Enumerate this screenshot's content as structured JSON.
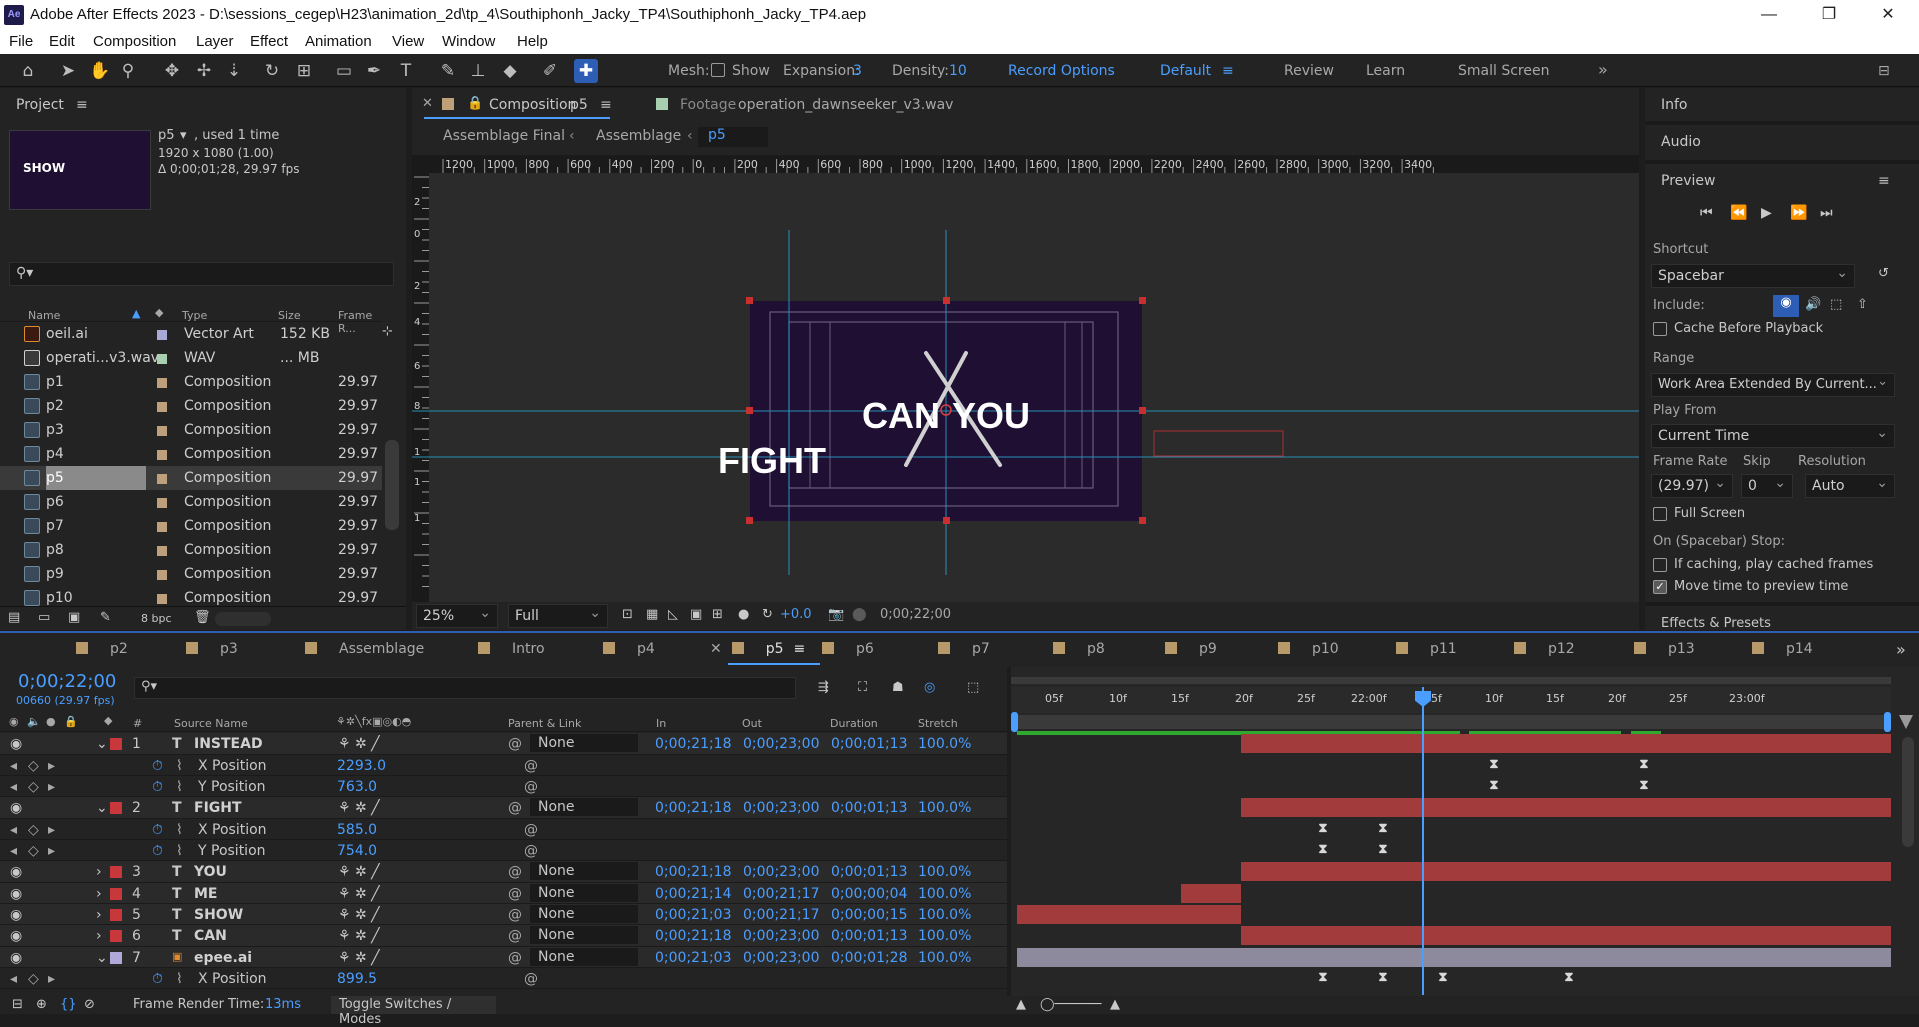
{
  "window": {
    "title": "Adobe After Effects 2023 - D:\\sessions_cegep\\H23\\animation_2d\\tp_4\\Southiphonh_Jacky_TP4\\Southiphonh_Jacky_TP4.aep",
    "app_icon": "Ae",
    "min": "—",
    "max": "❐",
    "close": "✕"
  },
  "menu": [
    "File",
    "Edit",
    "Composition",
    "Layer",
    "Effect",
    "Animation",
    "View",
    "Window",
    "Help"
  ],
  "toolbar": {
    "mesh_label": "Mesh:",
    "show_label": "Show",
    "expansion_label": "Expansion:",
    "expansion_value": "3",
    "density_label": "Density:",
    "density_value": "10",
    "record_options": "Record Options",
    "workspaces": [
      "Default",
      "Review",
      "Learn",
      "Small Screen"
    ],
    "more": "»"
  },
  "project": {
    "tab": "Project",
    "selected_name": "p5",
    "selected_used": ", used 1 time",
    "selected_res": "1920 x 1080 (1.00)",
    "selected_dur": "Δ 0;00;01;28, 29.97 fps",
    "thumb_text": "SHOW",
    "columns": {
      "name": "Name",
      "type": "Type",
      "size": "Size",
      "frame": "Frame R..."
    },
    "items": [
      {
        "name": "oeil.ai",
        "type": "Vector Art",
        "size": "152 KB",
        "frame": "",
        "color": "#a9a9d8",
        "kind": "ai"
      },
      {
        "name": "operati...v3.wav",
        "type": "WAV",
        "size": "... MB",
        "frame": "",
        "color": "#a8d0b0",
        "kind": "wav"
      },
      {
        "name": "p1",
        "type": "Composition",
        "size": "",
        "frame": "29.97",
        "color": "#c0a07a",
        "kind": "comp"
      },
      {
        "name": "p2",
        "type": "Composition",
        "size": "",
        "frame": "29.97",
        "color": "#c0a07a",
        "kind": "comp"
      },
      {
        "name": "p3",
        "type": "Composition",
        "size": "",
        "frame": "29.97",
        "color": "#c0a07a",
        "kind": "comp"
      },
      {
        "name": "p4",
        "type": "Composition",
        "size": "",
        "frame": "29.97",
        "color": "#c0a07a",
        "kind": "comp"
      },
      {
        "name": "p5",
        "type": "Composition",
        "size": "",
        "frame": "29.97",
        "color": "#c0a07a",
        "kind": "comp",
        "selected": true
      },
      {
        "name": "p6",
        "type": "Composition",
        "size": "",
        "frame": "29.97",
        "color": "#c0a07a",
        "kind": "comp"
      },
      {
        "name": "p7",
        "type": "Composition",
        "size": "",
        "frame": "29.97",
        "color": "#c0a07a",
        "kind": "comp"
      },
      {
        "name": "p8",
        "type": "Composition",
        "size": "",
        "frame": "29.97",
        "color": "#c0a07a",
        "kind": "comp"
      },
      {
        "name": "p9",
        "type": "Composition",
        "size": "",
        "frame": "29.97",
        "color": "#c0a07a",
        "kind": "comp"
      },
      {
        "name": "p10",
        "type": "Composition",
        "size": "",
        "frame": "29.97",
        "color": "#c0a07a",
        "kind": "comp"
      }
    ],
    "bpc": "8 bpc"
  },
  "viewer": {
    "comp_tab": "Composition",
    "comp_name": "p5",
    "footage_tab": "Footage",
    "footage_name": "operation_dawnseeker_v3.wav",
    "breadcrumbs": [
      "Assemblage Final",
      "Assemblage",
      "p5"
    ],
    "ruler_labels": [
      "1200",
      "1000",
      "800",
      "600",
      "400",
      "200",
      "0",
      "200",
      "400",
      "600",
      "800",
      "1000",
      "1200",
      "1400",
      "1600",
      "1800",
      "2000",
      "2200",
      "2400",
      "2600",
      "2800",
      "3000",
      "3200",
      "3400"
    ],
    "vruler": [
      "2",
      "0",
      "2",
      "4",
      "6",
      "8",
      "1",
      "1",
      "1"
    ],
    "words": {
      "can": "CAN",
      "you": "YOU",
      "fight": "FIGHT"
    },
    "zoom": "25%",
    "quality": "Full",
    "exposure": "+0.0",
    "timecode": "0;00;22;00"
  },
  "right": {
    "info": "Info",
    "audio": "Audio",
    "preview": "Preview",
    "shortcut_label": "Shortcut",
    "shortcut": "Spacebar",
    "include_label": "Include:",
    "cache_label": "Cache Before Playback",
    "range_label": "Range",
    "range": "Work Area Extended By Current...",
    "playfrom_label": "Play From",
    "playfrom": "Current Time",
    "framerate_label": "Frame Rate",
    "skip_label": "Skip",
    "resolution_label": "Resolution",
    "framerate": "(29.97)",
    "skip": "0",
    "resolution": "Auto",
    "fullscreen": "Full Screen",
    "onstop": "On (Spacebar) Stop:",
    "ifcaching": "If caching, play cached frames",
    "movetime": "Move time to preview time",
    "effects": "Effects & Presets"
  },
  "timeline": {
    "tabs": [
      "p2",
      "p3",
      "Assemblage",
      "Intro",
      "p4",
      "p5",
      "p6",
      "p7",
      "p8",
      "p9",
      "p10",
      "p11",
      "p12",
      "p13",
      "p14"
    ],
    "active_tab": "p5",
    "timecode": "0;00;22;00",
    "frames": "00660 (29.97 fps)",
    "cols": {
      "source": "Source Name",
      "parent": "Parent & Link",
      "in": "In",
      "out": "Out",
      "dur": "Duration",
      "stretch": "Stretch",
      "num": "#"
    },
    "ruler": [
      "05f",
      "10f",
      "15f",
      "20f",
      "25f",
      "22:00f",
      "05f",
      "10f",
      "15f",
      "20f",
      "25f",
      "23:00f"
    ],
    "layers": [
      {
        "kind": "layer",
        "num": "1",
        "name": "INSTEAD",
        "type": "T",
        "color": "#c8383a",
        "parent": "None",
        "in": "0;00;21;18",
        "out": "0;00;23;00",
        "dur": "0;00;01;13",
        "stretch": "100.0%",
        "expanded": true
      },
      {
        "kind": "prop",
        "name": "X Position",
        "value": "2293.0"
      },
      {
        "kind": "prop",
        "name": "Y Position",
        "value": "763.0"
      },
      {
        "kind": "layer",
        "num": "2",
        "name": "FIGHT",
        "type": "T",
        "color": "#c8383a",
        "parent": "None",
        "in": "0;00;21;18",
        "out": "0;00;23;00",
        "dur": "0;00;01;13",
        "stretch": "100.0%",
        "expanded": true
      },
      {
        "kind": "prop",
        "name": "X Position",
        "value": "585.0"
      },
      {
        "kind": "prop",
        "name": "Y Position",
        "value": "754.0"
      },
      {
        "kind": "layer",
        "num": "3",
        "name": "YOU",
        "type": "T",
        "color": "#c8383a",
        "parent": "None",
        "in": "0;00;21;18",
        "out": "0;00;23;00",
        "dur": "0;00;01;13",
        "stretch": "100.0%"
      },
      {
        "kind": "layer",
        "num": "4",
        "name": "ME",
        "type": "T",
        "color": "#c8383a",
        "parent": "None",
        "in": "0;00;21;14",
        "out": "0;00;21;17",
        "dur": "0;00;00;04",
        "stretch": "100.0%"
      },
      {
        "kind": "layer",
        "num": "5",
        "name": "SHOW",
        "type": "T",
        "color": "#c8383a",
        "parent": "None",
        "in": "0;00;21;03",
        "out": "0;00;21;17",
        "dur": "0;00;00;15",
        "stretch": "100.0%"
      },
      {
        "kind": "layer",
        "num": "6",
        "name": "CAN",
        "type": "T",
        "color": "#c8383a",
        "parent": "None",
        "in": "0;00;21;18",
        "out": "0;00;23;00",
        "dur": "0;00;01;13",
        "stretch": "100.0%"
      },
      {
        "kind": "layer",
        "num": "7",
        "name": "epee.ai",
        "type": "Ai",
        "color": "#b0a8d8",
        "parent": "None",
        "in": "0;00;21;03",
        "out": "0;00;23;00",
        "dur": "0;00;01;28",
        "stretch": "100.0%",
        "expanded": true
      },
      {
        "kind": "prop",
        "name": "X Position",
        "value": "899.5"
      }
    ],
    "footer": {
      "render_label": "Frame Render Time:",
      "render_value": "13ms",
      "toggle": "Toggle Switches / Modes"
    }
  }
}
